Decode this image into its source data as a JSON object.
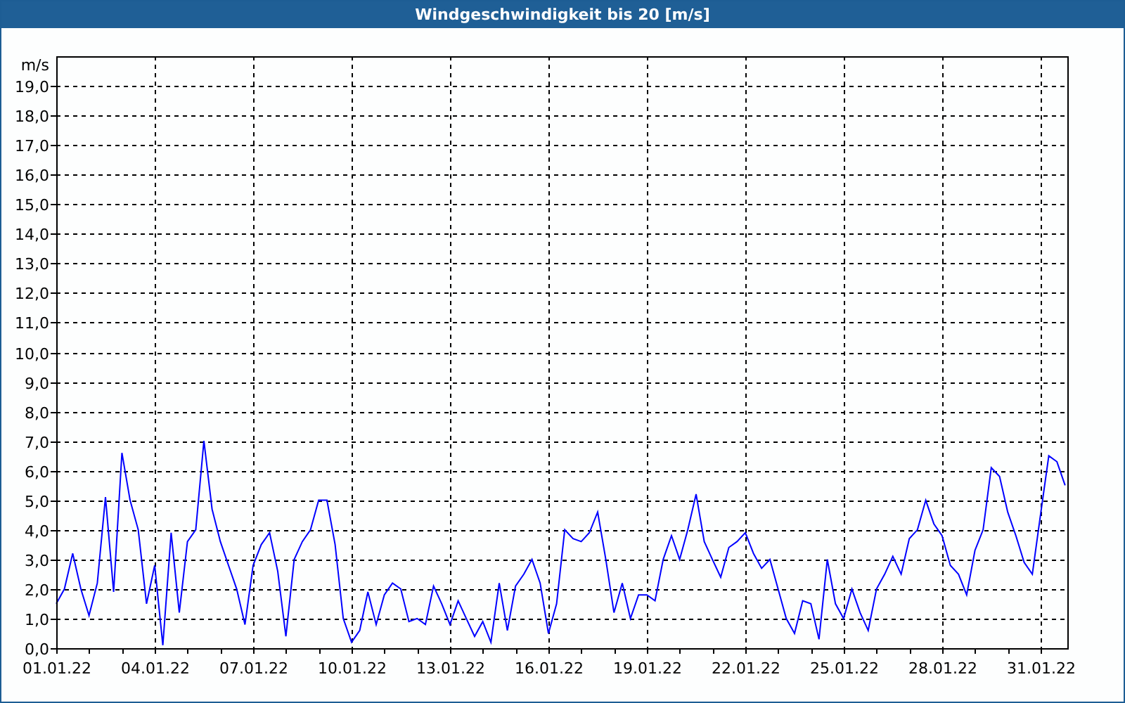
{
  "window": {
    "title": "Windgeschwindigkeit bis 20 [m/s]"
  },
  "chart": {
    "chart_data": {
      "type": "line",
      "grid": true,
      "ylabel": "m/s",
      "ylim": [
        0,
        20
      ],
      "categories": [
        "01.01.22",
        null,
        null,
        null,
        null,
        null,
        null,
        null,
        null,
        null,
        null,
        null,
        "04.01.22",
        null,
        null,
        null,
        null,
        null,
        null,
        null,
        null,
        null,
        null,
        null,
        "07.01.22",
        null,
        null,
        null,
        null,
        null,
        null,
        null,
        null,
        null,
        null,
        null,
        "10.01.22",
        null,
        null,
        null,
        null,
        null,
        null,
        null,
        null,
        null,
        null,
        null,
        "13.01.22",
        null,
        null,
        null,
        null,
        null,
        null,
        null,
        null,
        null,
        null,
        null,
        "16.01.22",
        null,
        null,
        null,
        null,
        null,
        null,
        null,
        null,
        null,
        null,
        null,
        "19.01.22",
        null,
        null,
        null,
        null,
        null,
        null,
        null,
        null,
        null,
        null,
        null,
        "22.01.22",
        null,
        null,
        null,
        null,
        null,
        null,
        null,
        null,
        null,
        null,
        null,
        "25.01.22",
        null,
        null,
        null,
        null,
        null,
        null,
        null,
        null,
        null,
        null,
        null,
        "28.01.22",
        null,
        null,
        null,
        null,
        null,
        null,
        null,
        null,
        null,
        null,
        null,
        "31.01.22",
        null,
        null,
        null
      ],
      "yticks": [
        {
          "value": 0,
          "label": "0,0"
        },
        {
          "value": 1,
          "label": "1,0"
        },
        {
          "value": 2,
          "label": "2,0"
        },
        {
          "value": 3,
          "label": "3,0"
        },
        {
          "value": 4,
          "label": "4,0"
        },
        {
          "value": 5,
          "label": "5,0"
        },
        {
          "value": 6,
          "label": "6,0"
        },
        {
          "value": 7,
          "label": "7,0"
        },
        {
          "value": 8,
          "label": "8,0"
        },
        {
          "value": 9,
          "label": "9,0"
        },
        {
          "value": 10,
          "label": "10,0"
        },
        {
          "value": 11,
          "label": "11,0"
        },
        {
          "value": 12,
          "label": "12,0"
        },
        {
          "value": 13,
          "label": "13,0"
        },
        {
          "value": 14,
          "label": "14,0"
        },
        {
          "value": 15,
          "label": "15,0"
        },
        {
          "value": 16,
          "label": "16,0"
        },
        {
          "value": 17,
          "label": "17,0"
        },
        {
          "value": 18,
          "label": "18,0"
        },
        {
          "value": 19,
          "label": "19,0"
        }
      ],
      "series": [
        {
          "color": "#0000ff",
          "values": [
            1.5,
            2.0,
            3.2,
            2.0,
            1.1,
            2.2,
            5.1,
            1.9,
            6.6,
            5.0,
            4.0,
            1.5,
            2.8,
            0.1,
            3.9,
            1.2,
            3.6,
            4.0,
            7.0,
            4.7,
            3.6,
            2.8,
            2.0,
            0.8,
            2.8,
            3.5,
            3.9,
            2.6,
            0.4,
            3.0,
            3.6,
            4.0,
            5.0,
            5.0,
            3.5,
            1.0,
            0.2,
            0.6,
            1.9,
            0.8,
            1.8,
            2.2,
            2.0,
            0.9,
            1.0,
            0.8,
            2.1,
            1.5,
            0.8,
            1.6,
            1.0,
            0.4,
            0.9,
            0.2,
            2.2,
            0.6,
            2.1,
            2.5,
            3.0,
            2.2,
            0.5,
            1.5,
            4.0,
            3.7,
            3.6,
            3.9,
            4.6,
            3.0,
            1.2,
            2.2,
            1.0,
            1.8,
            1.8,
            1.6,
            3.0,
            3.8,
            3.0,
            4.0,
            5.2,
            3.6,
            3.0,
            2.4,
            3.4,
            3.6,
            3.9,
            3.2,
            2.7,
            3.0,
            2.0,
            1.0,
            0.5,
            1.6,
            1.5,
            0.3,
            3.0,
            1.5,
            1.0,
            2.0,
            1.2,
            0.6,
            2.0,
            2.5,
            3.1,
            2.5,
            3.7,
            4.0,
            5.0,
            4.2,
            3.8,
            2.8,
            2.5,
            1.8,
            3.3,
            4.0,
            6.1,
            5.8,
            4.6,
            3.8,
            2.9,
            2.5,
            4.5,
            6.5,
            6.3,
            5.5
          ]
        }
      ]
    }
  }
}
